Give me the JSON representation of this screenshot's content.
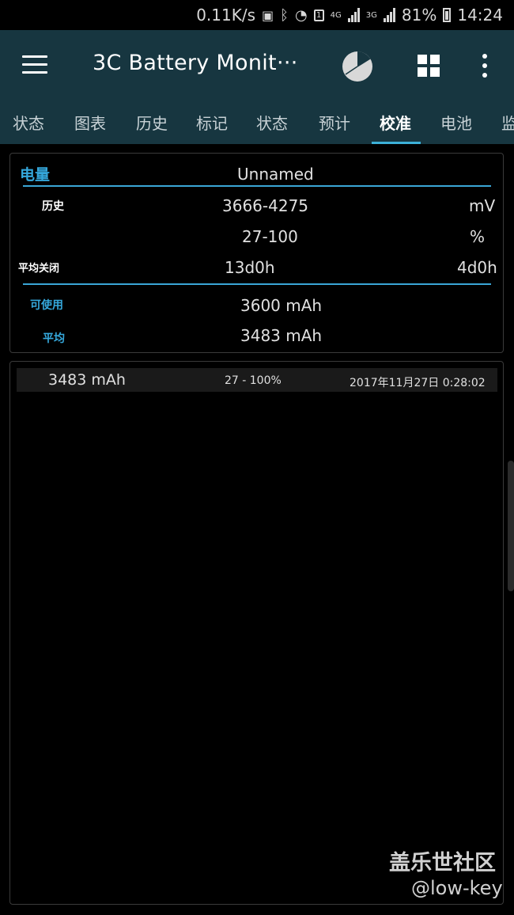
{
  "status_bar": {
    "net_speed": "0.11K/s",
    "net_4g": "4G",
    "net_3g": "3G",
    "sim_indicator": "1",
    "battery_percent": "81%",
    "time": "14:24",
    "icons": [
      "photo-icon",
      "bluetooth-icon",
      "wifi-icon",
      "sim-icon",
      "signal-icon",
      "battery-icon"
    ]
  },
  "toolbar": {
    "title": "3C Battery Monit···",
    "icons": [
      "menu-icon",
      "pie-chart-icon",
      "grid-icon",
      "more-vert-icon"
    ]
  },
  "tabs": {
    "items": [
      {
        "label": "状态"
      },
      {
        "label": "图表"
      },
      {
        "label": "历史"
      },
      {
        "label": "标记"
      },
      {
        "label": "状态"
      },
      {
        "label": "预计"
      },
      {
        "label": "校准"
      },
      {
        "label": "电池"
      },
      {
        "label": "监"
      }
    ],
    "active": "校准",
    "accent_color": "#3cb0d8"
  },
  "summary": {
    "capacity_label": "电量",
    "device_name": "Unnamed",
    "history_label": "历史",
    "voltage_range": "3666-4275",
    "voltage_unit": "mV",
    "percent_range": "27-100",
    "percent_unit": "%",
    "avg_off_label": "平均关闭",
    "avg_off_value_1": "13d0h",
    "avg_off_value_2": "4d0h",
    "usable_label": "可使用",
    "usable_value": "3600 mAh",
    "average_label": "平均",
    "average_value": "3483 mAh"
  },
  "history": {
    "rows": [
      {
        "capacity": "3483 mAh",
        "range": "27 - 100%",
        "datetime": "2017年11月27日 0:28:02"
      }
    ]
  },
  "watermark": {
    "site": "盖乐世社区",
    "user": "@low-key"
  }
}
